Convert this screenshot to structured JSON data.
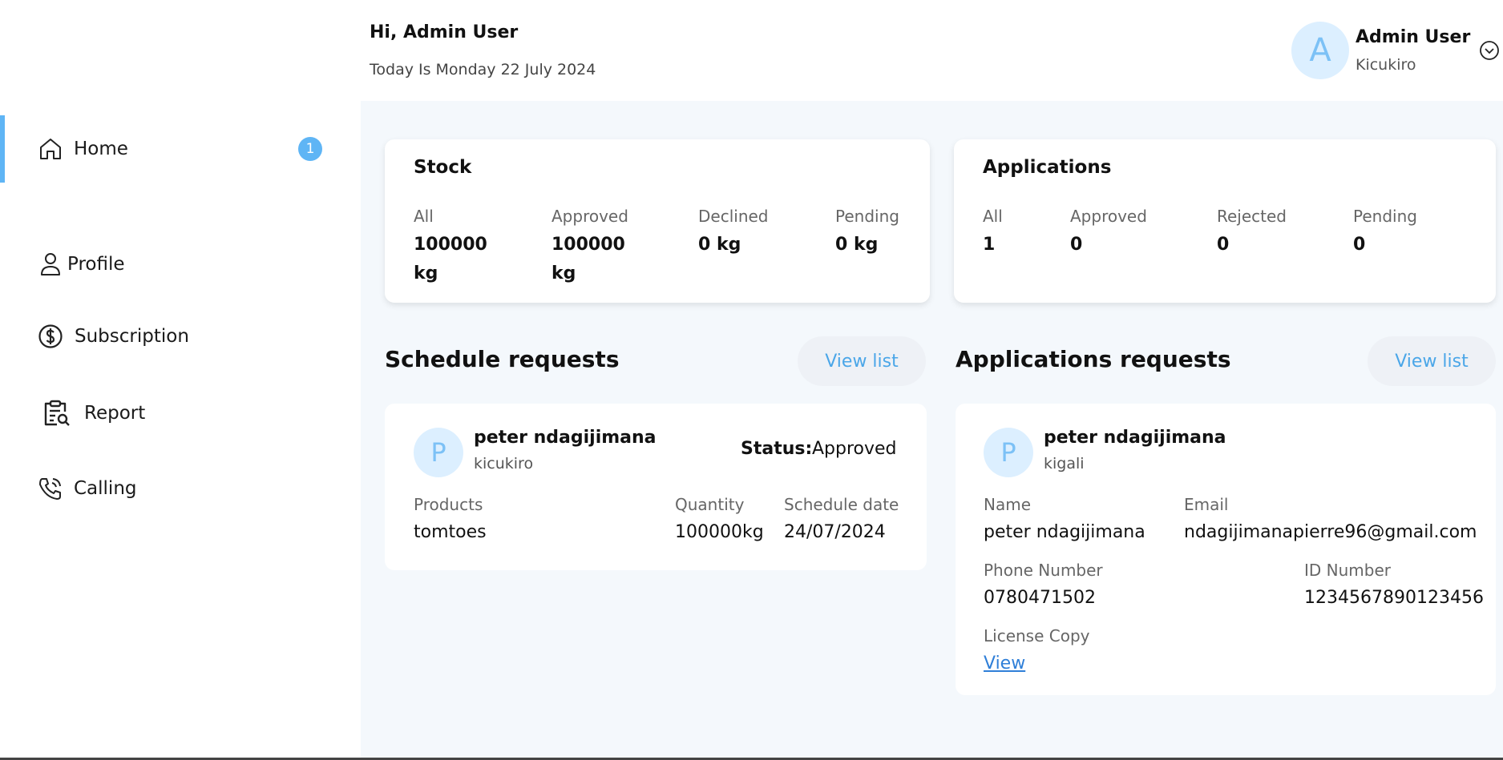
{
  "sidebar": {
    "items": [
      {
        "label": "Home",
        "icon": "home-icon",
        "badge": "1",
        "active": true
      },
      {
        "label": "Profile",
        "icon": "user-icon"
      },
      {
        "label": "Subscription",
        "icon": "dollar-circle-icon"
      },
      {
        "label": "Report",
        "icon": "report-search-icon"
      },
      {
        "label": "Calling",
        "icon": "phone-icon"
      }
    ]
  },
  "header": {
    "greeting": "Hi, Admin User",
    "date": "Today Is Monday 22 July 2024",
    "user": {
      "initial": "A",
      "name": "Admin User",
      "location": "Kicukiro"
    }
  },
  "stock": {
    "title": "Stock",
    "stats": [
      {
        "label": "All",
        "value": "100000 kg"
      },
      {
        "label": "Approved",
        "value": "100000 kg"
      },
      {
        "label": "Declined",
        "value": "0 kg"
      },
      {
        "label": "Pending",
        "value": "0 kg"
      }
    ]
  },
  "applications": {
    "title": "Applications",
    "stats": [
      {
        "label": "All",
        "value": "1"
      },
      {
        "label": "Approved",
        "value": "0"
      },
      {
        "label": "Rejected",
        "value": "0"
      },
      {
        "label": "Pending",
        "value": "0"
      }
    ]
  },
  "schedule": {
    "title": "Schedule requests",
    "view_label": "View list",
    "request": {
      "initial": "P",
      "name": "peter ndagijimana",
      "location": "kicukiro",
      "status_key": "Status:",
      "status_value": "Approved",
      "products_label": "Products",
      "products_value": "tomtoes",
      "quantity_label": "Quantity",
      "quantity_value": "100000kg",
      "date_label": "Schedule date",
      "date_value": "24/07/2024"
    }
  },
  "app_requests": {
    "title": "Applications requests",
    "view_label": "View list",
    "request": {
      "initial": "P",
      "name": "peter ndagijimana",
      "location": "kigali",
      "name_label": "Name",
      "name_value": "peter ndagijimana",
      "email_label": "Email",
      "email_value": "ndagijimanapierre96@gmail.com",
      "phone_label": "Phone Number",
      "phone_value": "0780471502",
      "id_label": "ID Number",
      "id_value": "1234567890123456",
      "license_label": "License Copy",
      "license_link": "View"
    }
  },
  "colors": {
    "accent": "#5fb5f5",
    "link": "#2f7fd8",
    "main_bg": "#f4f8fc"
  }
}
